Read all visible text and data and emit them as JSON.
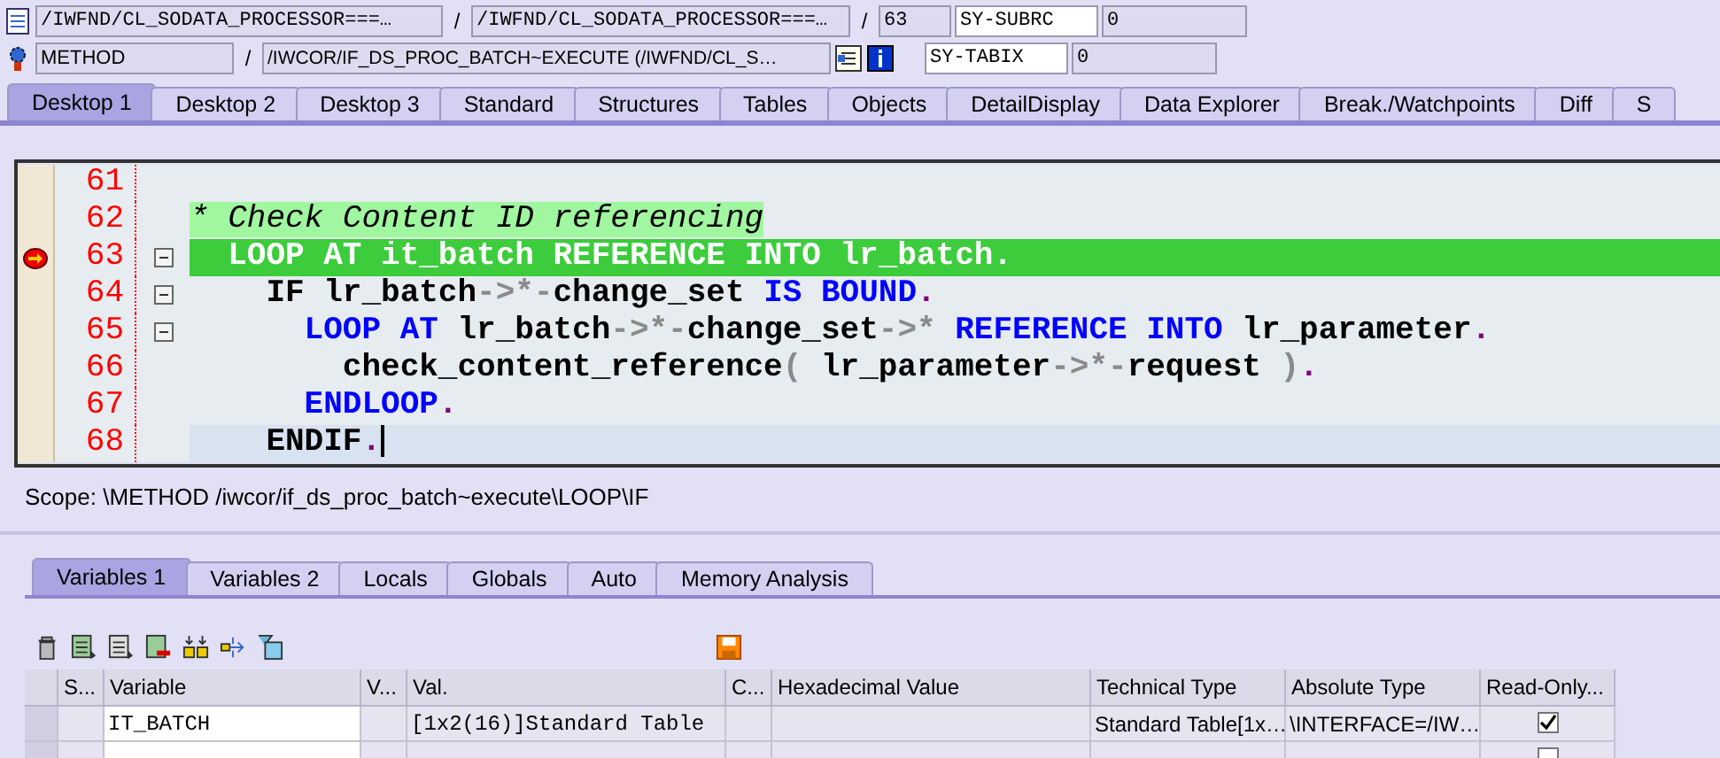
{
  "header": {
    "program": "/IWFND/CL_SODATA_PROCESSOR===…",
    "include": "/IWFND/CL_SODATA_PROCESSOR===…",
    "line": "63",
    "event_type": "METHOD",
    "event": "/IWCOR/IF_DS_PROC_BATCH~EXECUTE (/IWFND/CL_S…",
    "separators": [
      "/",
      "/",
      "/"
    ],
    "sy_fields": [
      {
        "name": "SY-SUBRC",
        "value": "0"
      },
      {
        "name": "SY-TABIX",
        "value": "0"
      }
    ]
  },
  "desktop_tabs": [
    {
      "label": "Desktop 1",
      "selected": true
    },
    {
      "label": "Desktop 2",
      "selected": false
    },
    {
      "label": "Desktop 3",
      "selected": false
    },
    {
      "label": "Standard",
      "selected": false
    },
    {
      "label": "Structures",
      "selected": false
    },
    {
      "label": "Tables",
      "selected": false
    },
    {
      "label": "Objects",
      "selected": false
    },
    {
      "label": "DetailDisplay",
      "selected": false
    },
    {
      "label": "Data Explorer",
      "selected": false
    },
    {
      "label": "Break./Watchpoints",
      "selected": false
    },
    {
      "label": "Diff",
      "selected": false
    },
    {
      "label": "S",
      "selected": false
    }
  ],
  "editor": {
    "lines": [
      {
        "number": "61",
        "breakpoint": false,
        "executing": false,
        "cursor": false,
        "foldable": false
      },
      {
        "number": "62",
        "breakpoint": false,
        "executing": false,
        "cursor": false,
        "foldable": false,
        "tokens": [
          {
            "kind": "comment",
            "text": "* Check Content ID referencing"
          }
        ]
      },
      {
        "number": "63",
        "breakpoint": true,
        "executing": true,
        "cursor": false,
        "foldable": true,
        "tokens": [
          {
            "kind": "kw",
            "text": "  LOOP AT it_batch REFERENCE INTO lr_batch."
          }
        ]
      },
      {
        "number": "64",
        "breakpoint": false,
        "executing": false,
        "cursor": false,
        "foldable": true,
        "tokens": [
          {
            "kind": "id",
            "text": "    IF lr_batch"
          },
          {
            "kind": "op",
            "text": "->*-"
          },
          {
            "kind": "id",
            "text": "change_set "
          },
          {
            "kind": "kw",
            "text": "IS BOUND"
          },
          {
            "kind": "period",
            "text": "."
          }
        ]
      },
      {
        "number": "65",
        "breakpoint": false,
        "executing": false,
        "cursor": false,
        "foldable": true,
        "tokens": [
          {
            "kind": "kw",
            "text": "      LOOP AT "
          },
          {
            "kind": "id",
            "text": "lr_batch"
          },
          {
            "kind": "op",
            "text": "->*-"
          },
          {
            "kind": "id",
            "text": "change_set"
          },
          {
            "kind": "op",
            "text": "->*"
          },
          {
            "kind": "kw",
            "text": " REFERENCE INTO "
          },
          {
            "kind": "id",
            "text": "lr_parameter"
          },
          {
            "kind": "period",
            "text": "."
          }
        ]
      },
      {
        "number": "66",
        "breakpoint": false,
        "executing": false,
        "cursor": false,
        "foldable": false,
        "tokens": [
          {
            "kind": "id",
            "text": "        check_content_reference"
          },
          {
            "kind": "op",
            "text": "( "
          },
          {
            "kind": "id",
            "text": "lr_parameter"
          },
          {
            "kind": "op",
            "text": "->*-"
          },
          {
            "kind": "id",
            "text": "request "
          },
          {
            "kind": "op",
            "text": ")"
          },
          {
            "kind": "period",
            "text": "."
          }
        ]
      },
      {
        "number": "67",
        "breakpoint": false,
        "executing": false,
        "cursor": false,
        "foldable": false,
        "tokens": [
          {
            "kind": "kw",
            "text": "      ENDLOOP"
          },
          {
            "kind": "period",
            "text": "."
          }
        ]
      },
      {
        "number": "68",
        "breakpoint": false,
        "executing": false,
        "cursor": true,
        "foldable": false,
        "tokens": [
          {
            "kind": "id",
            "text": "    ENDIF"
          },
          {
            "kind": "period",
            "text": "."
          }
        ]
      }
    ]
  },
  "scope": "Scope: \\METHOD /iwcor/if_ds_proc_batch~execute\\LOOP\\IF",
  "variable_tabs": [
    {
      "label": "Variables 1",
      "selected": true
    },
    {
      "label": "Variables 2",
      "selected": false
    },
    {
      "label": "Locals",
      "selected": false
    },
    {
      "label": "Globals",
      "selected": false
    },
    {
      "label": "Auto",
      "selected": false
    },
    {
      "label": "Memory Analysis",
      "selected": false
    }
  ],
  "table": {
    "columns": [
      "S...",
      "Variable",
      "V...",
      "Val.",
      "C...",
      "Hexadecimal Value",
      "Technical Type",
      "Absolute Type",
      "Read-Only..."
    ],
    "rows": [
      {
        "variable": "IT_BATCH",
        "value": "[1x2(16)]Standard Table",
        "technical_type": "Standard Table[1x…",
        "absolute_type": "\\INTERFACE=/IW…",
        "read_only": true
      },
      {
        "read_only": false
      }
    ]
  }
}
